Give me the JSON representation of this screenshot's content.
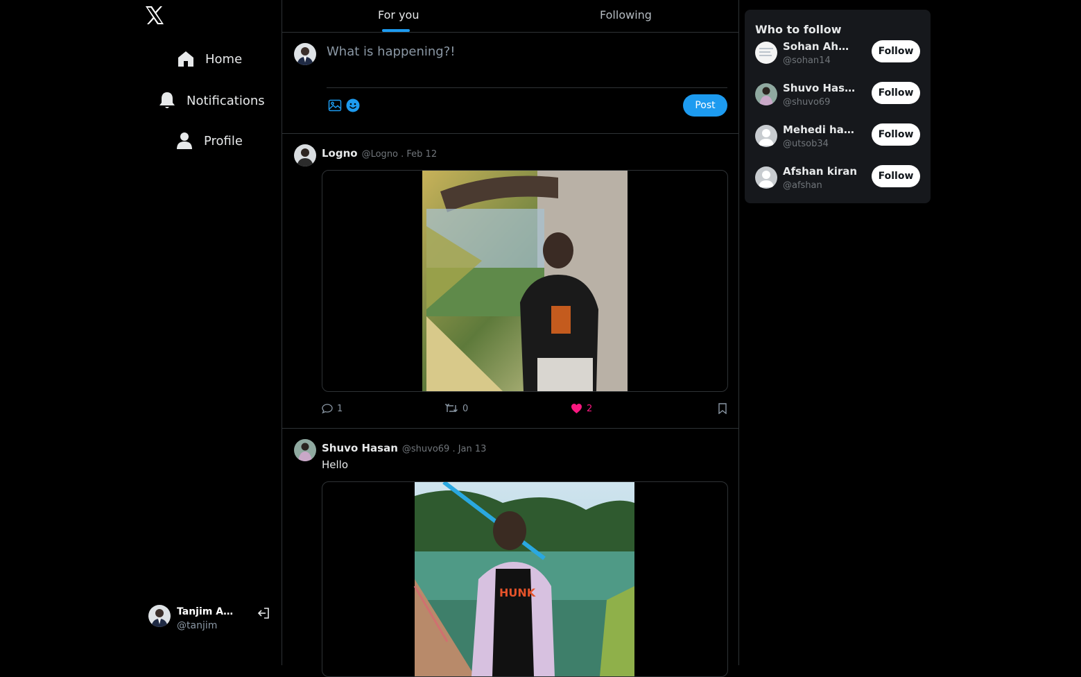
{
  "sidebar": {
    "logo_icon": "x-logo-icon",
    "nav": [
      {
        "label": "Home",
        "icon": "home-icon"
      },
      {
        "label": "Notifications",
        "icon": "bell-icon"
      },
      {
        "label": "Profile",
        "icon": "person-icon"
      }
    ],
    "account": {
      "name": "Tanjim Al...",
      "handle": "@tanjim",
      "logout_icon": "logout-icon"
    }
  },
  "tabs": [
    {
      "label": "For you",
      "active": true
    },
    {
      "label": "Following",
      "active": false
    }
  ],
  "composer": {
    "placeholder": "What is happening?!",
    "post_label": "Post",
    "icons": [
      "image-icon",
      "emoji-icon"
    ]
  },
  "tweets": [
    {
      "name": "Logno",
      "meta": "@Logno . Feb 12",
      "text": "",
      "replies": "1",
      "retweets": "0",
      "likes": "2",
      "liked": true
    },
    {
      "name": "Shuvo Hasan",
      "meta": "@shuvo69 . Jan 13",
      "text": "Hello"
    }
  ],
  "who_to_follow": {
    "title": "Who to follow",
    "follow_label": "Follow",
    "users": [
      {
        "name": "Sohan Ahmed",
        "handle": "@sohan14"
      },
      {
        "name": "Shuvo Hasan",
        "handle": "@shuvo69"
      },
      {
        "name": "Mehedi hasa...",
        "handle": "@utsob34"
      },
      {
        "name": "Afshan kiran",
        "handle": "@afshan"
      }
    ]
  },
  "colors": {
    "accent": "#1d9bf0",
    "like": "#f91880",
    "background": "#000000",
    "card": "#16181c"
  }
}
